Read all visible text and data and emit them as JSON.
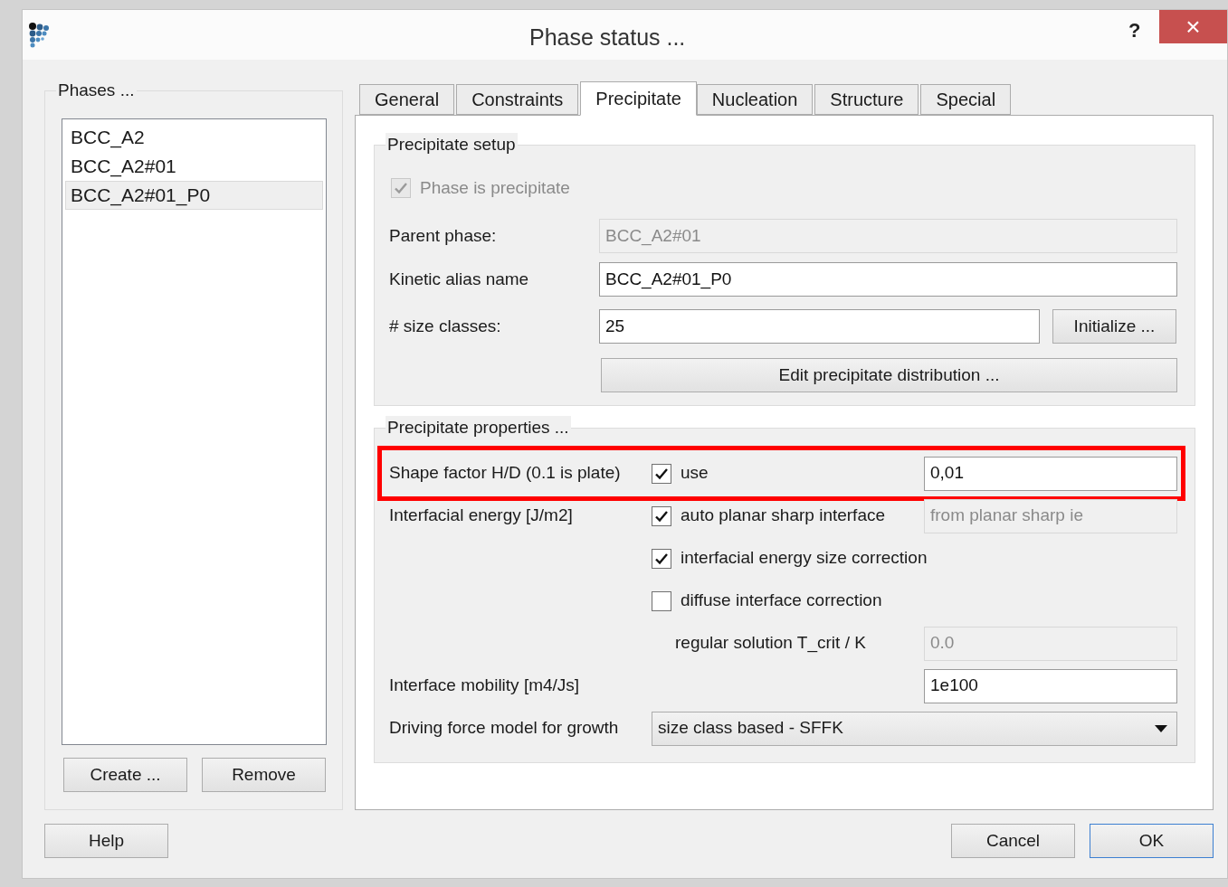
{
  "window": {
    "title": "Phase status ...",
    "help": "?",
    "close": "×"
  },
  "phases": {
    "title": "Phases ...",
    "items": [
      {
        "label": "BCC_A2",
        "selected": false
      },
      {
        "label": "BCC_A2#01",
        "selected": false
      },
      {
        "label": "BCC_A2#01_P0",
        "selected": true
      }
    ],
    "buttons": [
      "Create ...",
      "Remove"
    ]
  },
  "tabs": [
    {
      "label": "General",
      "selected": false
    },
    {
      "label": "Constraints",
      "selected": false
    },
    {
      "label": "Precipitate",
      "selected": true
    },
    {
      "label": "Nucleation",
      "selected": false
    },
    {
      "label": "Structure",
      "selected": false
    },
    {
      "label": "Special",
      "selected": false
    }
  ],
  "precipitate_setup": {
    "title": "Precipitate setup",
    "phase_is_precipitate": {
      "label": "Phase is precipitate",
      "checked": true,
      "disabled": true
    },
    "fields": [
      {
        "label": "Parent phase:",
        "value": "BCC_A2#01",
        "disabled": true
      },
      {
        "label": "Kinetic alias name",
        "value": "BCC_A2#01_P0",
        "disabled": false
      },
      {
        "label": "# size classes:",
        "value": "25",
        "disabled": false,
        "button": "Initialize ..."
      }
    ],
    "edit_button": "Edit precipitate distribution ..."
  },
  "precipitate_properties": {
    "title": "Precipitate properties ...",
    "rows": [
      {
        "kind": "check_field",
        "label": "Shape factor H/D (0.1 is plate)",
        "check": {
          "label": "use",
          "checked": true
        },
        "value": "0,01",
        "disabled": false,
        "highlighted": true
      },
      {
        "kind": "check_field",
        "label": "Interfacial energy [J/m2]",
        "check": {
          "label": "auto planar sharp interface",
          "checked": true
        },
        "value": "from planar sharp ie",
        "disabled": true,
        "highlighted": false
      },
      {
        "kind": "check",
        "check": {
          "label": "interfacial energy size correction",
          "checked": true
        }
      },
      {
        "kind": "check",
        "check": {
          "label": "diffuse interface correction",
          "checked": false
        }
      },
      {
        "kind": "sub_field",
        "label": "regular solution T_crit / K",
        "value": "0.0",
        "disabled": true
      },
      {
        "kind": "field",
        "label": "Interface mobility [m4/Js]",
        "value": "1e100",
        "disabled": false
      },
      {
        "kind": "dropdown",
        "label": "Driving force model for growth",
        "value": "size class based - SFFK"
      }
    ]
  },
  "buttons": {
    "help": "Help",
    "cancel": "Cancel",
    "ok": "OK"
  }
}
